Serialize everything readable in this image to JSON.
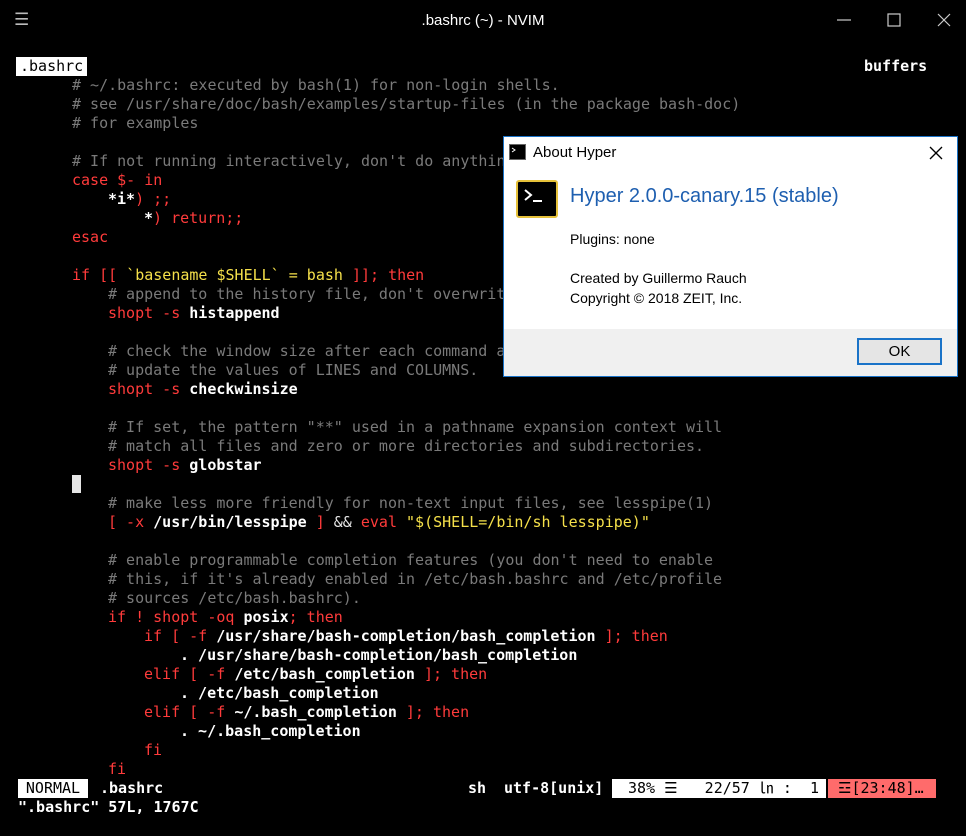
{
  "window": {
    "title": ".bashrc (~) - NVIM",
    "menu_icon": "hamburger-icon"
  },
  "editor": {
    "tab_label": ".bashrc",
    "buffers_label": "buffers",
    "lines": [
      {
        "row": 1,
        "indent": 0,
        "segments": [
          {
            "cls": "c-comment",
            "text": "# ~/.bashrc: executed by bash(1) for non-login shells."
          }
        ]
      },
      {
        "row": 2,
        "indent": 0,
        "segments": [
          {
            "cls": "c-comment",
            "text": "# see /usr/share/doc/bash/examples/startup-files (in the package bash-doc)"
          }
        ]
      },
      {
        "row": 3,
        "indent": 0,
        "segments": [
          {
            "cls": "c-comment",
            "text": "# for examples"
          }
        ]
      },
      {
        "row": 5,
        "indent": 0,
        "segments": [
          {
            "cls": "c-comment",
            "text": "# If not running interactively, don't do anythin"
          }
        ]
      },
      {
        "row": 6,
        "indent": 0,
        "segments": [
          {
            "cls": "c-kw",
            "text": "case $- in"
          }
        ]
      },
      {
        "row": 7,
        "indent": 4,
        "segments": [
          {
            "cls": "c-bold",
            "text": "*i*"
          },
          {
            "cls": "c-kw",
            "text": ") ;;"
          }
        ]
      },
      {
        "row": 8,
        "indent": 8,
        "segments": [
          {
            "cls": "c-bold",
            "text": "*"
          },
          {
            "cls": "c-kw",
            "text": ") return;;"
          }
        ]
      },
      {
        "row": 9,
        "indent": 0,
        "segments": [
          {
            "cls": "c-kw",
            "text": "esac"
          }
        ]
      },
      {
        "row": 11,
        "indent": 0,
        "segments": [
          {
            "cls": "c-kw",
            "text": "if [[ "
          },
          {
            "cls": "c-str",
            "text": "`basename $SHELL` = bash"
          },
          {
            "cls": "c-kw",
            "text": " ]]; then"
          }
        ]
      },
      {
        "row": 12,
        "indent": 4,
        "segments": [
          {
            "cls": "c-comment",
            "text": "# append to the history file, don't overwrit"
          }
        ]
      },
      {
        "row": 13,
        "indent": 4,
        "segments": [
          {
            "cls": "c-kw",
            "text": "shopt -s "
          },
          {
            "cls": "c-bold",
            "text": "histappend"
          }
        ]
      },
      {
        "row": 15,
        "indent": 4,
        "segments": [
          {
            "cls": "c-comment",
            "text": "# check the window size after each command a"
          }
        ]
      },
      {
        "row": 16,
        "indent": 4,
        "segments": [
          {
            "cls": "c-comment",
            "text": "# update the values of LINES and COLUMNS."
          }
        ]
      },
      {
        "row": 17,
        "indent": 4,
        "segments": [
          {
            "cls": "c-kw",
            "text": "shopt -s "
          },
          {
            "cls": "c-bold",
            "text": "checkwinsize"
          }
        ]
      },
      {
        "row": 19,
        "indent": 4,
        "segments": [
          {
            "cls": "c-comment",
            "text": "# If set, the pattern \"**\" used in a pathname expansion context will"
          }
        ]
      },
      {
        "row": 20,
        "indent": 4,
        "segments": [
          {
            "cls": "c-comment",
            "text": "# match all files and zero or more directories and subdirectories."
          }
        ]
      },
      {
        "row": 21,
        "indent": 4,
        "segments": [
          {
            "cls": "c-kw",
            "text": "shopt -s "
          },
          {
            "cls": "c-bold",
            "text": "globstar"
          }
        ]
      },
      {
        "row": 23,
        "indent": 4,
        "segments": [
          {
            "cls": "c-comment",
            "text": "# make less more friendly for non-text input files, see lesspipe(1)"
          }
        ]
      },
      {
        "row": 24,
        "indent": 4,
        "segments": [
          {
            "cls": "c-kw",
            "text": "[ -x "
          },
          {
            "cls": "c-bold",
            "text": "/usr/bin/lesspipe"
          },
          {
            "cls": "c-kw",
            "text": " ] "
          },
          {
            "cls": "c-plain",
            "text": "&&"
          },
          {
            "cls": "c-kw",
            "text": " eval "
          },
          {
            "cls": "c-str",
            "text": "\"$(SHELL=/bin/sh lesspipe)\""
          }
        ]
      },
      {
        "row": 26,
        "indent": 4,
        "segments": [
          {
            "cls": "c-comment",
            "text": "# enable programmable completion features (you don't need to enable"
          }
        ]
      },
      {
        "row": 27,
        "indent": 4,
        "segments": [
          {
            "cls": "c-comment",
            "text": "# this, if it's already enabled in /etc/bash.bashrc and /etc/profile"
          }
        ]
      },
      {
        "row": 28,
        "indent": 4,
        "segments": [
          {
            "cls": "c-comment",
            "text": "# sources /etc/bash.bashrc)."
          }
        ]
      },
      {
        "row": 29,
        "indent": 4,
        "segments": [
          {
            "cls": "c-kw",
            "text": "if ! shopt -oq "
          },
          {
            "cls": "c-bold",
            "text": "posix"
          },
          {
            "cls": "c-kw",
            "text": "; then"
          }
        ]
      },
      {
        "row": 30,
        "indent": 8,
        "segments": [
          {
            "cls": "c-kw",
            "text": "if [ -f "
          },
          {
            "cls": "c-bold",
            "text": "/usr/share/bash-completion/bash_completion"
          },
          {
            "cls": "c-kw",
            "text": " ]; then"
          }
        ]
      },
      {
        "row": 31,
        "indent": 12,
        "segments": [
          {
            "cls": "c-bold",
            "text": ". /usr/share/bash-completion/bash_completion"
          }
        ]
      },
      {
        "row": 32,
        "indent": 8,
        "segments": [
          {
            "cls": "c-kw",
            "text": "elif [ -f "
          },
          {
            "cls": "c-bold",
            "text": "/etc/bash_completion"
          },
          {
            "cls": "c-kw",
            "text": " ]; then"
          }
        ]
      },
      {
        "row": 33,
        "indent": 12,
        "segments": [
          {
            "cls": "c-bold",
            "text": ". /etc/bash_completion"
          }
        ]
      },
      {
        "row": 34,
        "indent": 8,
        "segments": [
          {
            "cls": "c-kw",
            "text": "elif [ -f "
          },
          {
            "cls": "c-bold",
            "text": "~/.bash_completion"
          },
          {
            "cls": "c-kw",
            "text": " ]; then"
          }
        ]
      },
      {
        "row": 35,
        "indent": 12,
        "segments": [
          {
            "cls": "c-bold",
            "text": ". ~/.bash_completion"
          }
        ]
      },
      {
        "row": 36,
        "indent": 8,
        "segments": [
          {
            "cls": "c-kw",
            "text": "fi"
          }
        ]
      },
      {
        "row": 37,
        "indent": 4,
        "segments": [
          {
            "cls": "c-kw",
            "text": "fi"
          }
        ]
      }
    ]
  },
  "statusline": {
    "mode": "NORMAL",
    "filename": ".bashrc",
    "filetype": "sh",
    "encoding": "utf-8[unix]",
    "position": "38% ☰   22/57 ㏑ :  1",
    "time": "☲[23:48]…"
  },
  "cmdline": "\".bashrc\" 57L, 1767C",
  "dialog": {
    "title": "About Hyper",
    "app_name": "Hyper 2.0.0-canary.15 (stable)",
    "plugins": "Plugins: none",
    "created_by": "Created by Guillermo Rauch",
    "copyright": "Copyright © 2018 ZEIT, Inc.",
    "ok_label": "OK"
  },
  "colors": {
    "background": "#000000",
    "keyword": "#ff3b3b",
    "comment": "#7a7a7a",
    "string": "#f5e04a",
    "dialog_accent": "#1a73c8",
    "app_name": "#1e5fb0",
    "time_badge": "#ff6b6b"
  }
}
